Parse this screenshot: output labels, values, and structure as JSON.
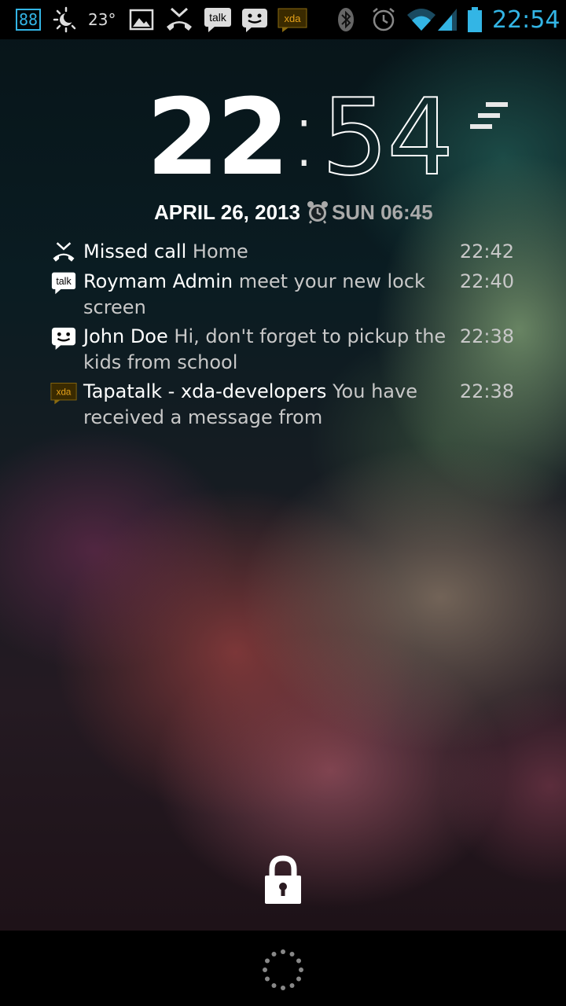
{
  "status_bar": {
    "badge": "88",
    "temperature": "23°",
    "talk_label": "talk",
    "xda_label": "xda",
    "time": "22:54",
    "icons": [
      "88-badge",
      "weather-icon",
      "gallery-icon",
      "missed-call-icon",
      "talk-icon",
      "messaging-icon",
      "xda-icon",
      "bluetooth-icon",
      "alarm-icon",
      "wifi-icon",
      "signal-icon",
      "battery-icon"
    ],
    "accent_color": "#33b5e5"
  },
  "lockscreen": {
    "clock_hours": "22",
    "clock_colon": ":",
    "clock_minutes": "54",
    "date": "APRIL 26, 2013",
    "alarm": "SUN 06:45"
  },
  "notifications": [
    {
      "icon": "missed-call-icon",
      "title": "Missed call",
      "text": "Home",
      "time": "22:42"
    },
    {
      "icon": "talk-icon",
      "icon_label": "talk",
      "title": "Roymam Admin",
      "text": "meet your new lock screen",
      "time": "22:40"
    },
    {
      "icon": "messaging-icon",
      "title": "John Doe",
      "text": "Hi,  don't forget to pickup the kids from school",
      "time": "22:38"
    },
    {
      "icon": "xda-icon",
      "icon_label": "xda",
      "title": "Tapatalk - xda-developers",
      "text": "You have received a message from",
      "time": "22:38"
    }
  ]
}
